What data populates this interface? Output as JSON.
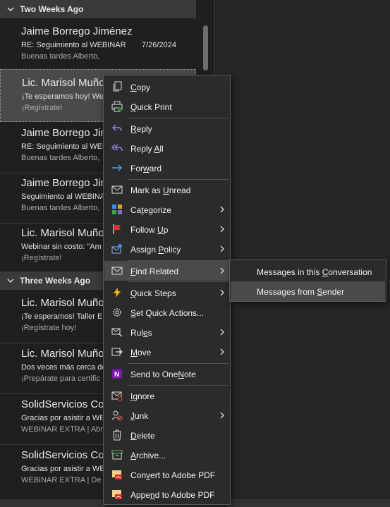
{
  "groups": [
    {
      "label": "Two Weeks Ago"
    },
    {
      "label": "Three Weeks Ago"
    }
  ],
  "messages": [
    {
      "from": "Jaime Borrego Jiménez",
      "subject": "RE: Seguimiento al WEBINAR",
      "preview": "Buenas tardes Alberto,",
      "date": "7/26/2024"
    },
    {
      "from": "Lic. Marisol Muñoz",
      "subject": "¡Te esperamos hoy! Webinar",
      "preview": "¡Regístrate!",
      "date": ""
    },
    {
      "from": "Jaime Borrego Jiménez",
      "subject": "RE: Seguimiento al WEBINAR",
      "preview": "Buenas tardes Alberto,",
      "date": ""
    },
    {
      "from": "Jaime Borrego Jiménez",
      "subject": "Seguimiento al WEBINAR",
      "preview": "Buenas tardes Alberto,",
      "date": ""
    },
    {
      "from": "Lic. Marisol Muñoz",
      "subject": "Webinar sin costo: \"Am",
      "preview": "¡Regístrate!",
      "date": ""
    },
    {
      "from": "Lic. Marisol Muñoz",
      "subject": "¡Te esperamos! Taller E",
      "preview": "¡Regístrate hoy!",
      "date": ""
    },
    {
      "from": "Lic. Marisol Muñoz",
      "subject": "Dos veces más cerca de",
      "preview": "¡Prepárate para certific",
      "date": ""
    },
    {
      "from": "SolidServicios Corp",
      "subject": "Gracias por asistir a WE",
      "preview": "WEBINAR EXTRA | Abre",
      "date": ""
    },
    {
      "from": "SolidServicios Corp",
      "subject": "Gracias por asistir a WE",
      "preview": "WEBINAR EXTRA | De",
      "date": ""
    }
  ],
  "context_menu": {
    "items": [
      {
        "pre": "",
        "u": "C",
        "post": "opy"
      },
      {
        "pre": "",
        "u": "Q",
        "post": "uick Print"
      },
      {
        "pre": "",
        "u": "R",
        "post": "eply"
      },
      {
        "pre": "Reply ",
        "u": "A",
        "post": "ll"
      },
      {
        "pre": "For",
        "u": "w",
        "post": "ard"
      },
      {
        "pre": "Mark as ",
        "u": "U",
        "post": "nread"
      },
      {
        "pre": "Ca",
        "u": "t",
        "post": "egorize"
      },
      {
        "pre": "Follow ",
        "u": "U",
        "post": "p"
      },
      {
        "pre": "Assign ",
        "u": "P",
        "post": "olicy"
      },
      {
        "pre": "",
        "u": "F",
        "post": "ind Related"
      },
      {
        "pre": "",
        "u": "Q",
        "post": "uick Steps"
      },
      {
        "pre": "",
        "u": "S",
        "post": "et Quick Actions..."
      },
      {
        "pre": "Rul",
        "u": "e",
        "post": "s"
      },
      {
        "pre": "",
        "u": "M",
        "post": "ove"
      },
      {
        "pre": "Send to One",
        "u": "N",
        "post": "ote"
      },
      {
        "pre": "",
        "u": "I",
        "post": "gnore"
      },
      {
        "pre": "",
        "u": "J",
        "post": "unk"
      },
      {
        "pre": "",
        "u": "D",
        "post": "elete"
      },
      {
        "pre": "",
        "u": "A",
        "post": "rchive..."
      },
      {
        "pre": "Con",
        "u": "v",
        "post": "ert to Adobe PDF"
      },
      {
        "pre": "Appe",
        "u": "n",
        "post": "d to Adobe PDF"
      }
    ]
  },
  "submenu": {
    "items": [
      {
        "pre": "Messages in this ",
        "u": "C",
        "post": "onversation"
      },
      {
        "pre": "Messages from ",
        "u": "S",
        "post": "ender"
      }
    ]
  },
  "colors": {
    "accent_reply": "#8b8bf0",
    "forward": "#4fa3f7",
    "flag": "#e03030",
    "quick_steps": "#f5b800",
    "onenote": "#7719aa"
  }
}
